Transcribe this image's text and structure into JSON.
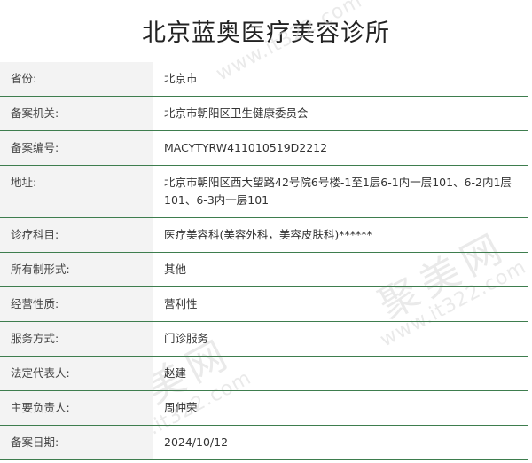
{
  "title": "北京蓝奥医疗美容诊所",
  "watermark": {
    "url": "www.it322.com",
    "brand": "聚美网"
  },
  "rows": [
    {
      "label": "省份:",
      "value": "北京市"
    },
    {
      "label": "备案机关:",
      "value": "北京市朝阳区卫生健康委员会"
    },
    {
      "label": "备案编号:",
      "value": "MACYTYRW411010519D2212"
    },
    {
      "label": "地址:",
      "value": "北京市朝阳区西大望路42号院6号楼-1至1层6-1内一层101、6-2内1层101、6-3内一层101"
    },
    {
      "label": "诊疗科目:",
      "value": "医疗美容科(美容外科，美容皮肤科)******"
    },
    {
      "label": "所有制形式:",
      "value": "其他"
    },
    {
      "label": "经营性质:",
      "value": "营利性"
    },
    {
      "label": "服务方式:",
      "value": "门诊服务"
    },
    {
      "label": "法定代表人:",
      "value": "赵建"
    },
    {
      "label": "主要负责人:",
      "value": "周仲荣"
    },
    {
      "label": "备案日期:",
      "value": "2024/10/12"
    }
  ]
}
